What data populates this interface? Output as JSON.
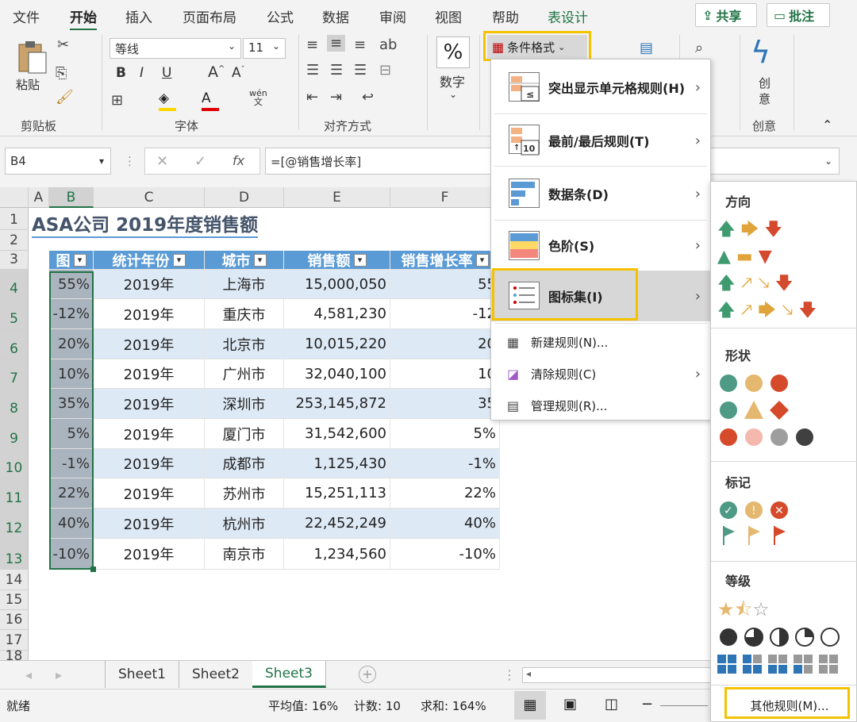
{
  "menu": {
    "tabs": [
      "文件",
      "开始",
      "插入",
      "页面布局",
      "公式",
      "数据",
      "审阅",
      "视图",
      "帮助",
      "表设计"
    ],
    "share_label": "共享",
    "comment_label": "批注"
  },
  "ribbon": {
    "paste_label": "粘贴",
    "clipboard_label": "剪贴板",
    "font_name": "等线",
    "font_size": "11",
    "font_group_label": "字体",
    "align_group_label": "对齐方式",
    "number_label": "数字",
    "cf_button_label": "条件格式",
    "create_label_1": "创",
    "create_label_2": "意",
    "create_group_label": "创意"
  },
  "formula_bar": {
    "name_box": "B4",
    "formula": "=[@销售增长率]"
  },
  "sheet": {
    "columns": [
      "A",
      "B",
      "C",
      "D",
      "E",
      "F"
    ],
    "title": "ASA公司 2019年度销售额",
    "headers": [
      "图",
      "统计年份",
      "城市",
      "销售额",
      "销售增长率"
    ],
    "rows": [
      {
        "icon": "55%",
        "year": "2019年",
        "city": "上海市",
        "sales": "15,000,050",
        "growth": "55"
      },
      {
        "icon": "-12%",
        "year": "2019年",
        "city": "重庆市",
        "sales": "4,581,230",
        "growth": "-12"
      },
      {
        "icon": "20%",
        "year": "2019年",
        "city": "北京市",
        "sales": "10,015,220",
        "growth": "20"
      },
      {
        "icon": "10%",
        "year": "2019年",
        "city": "广州市",
        "sales": "32,040,100",
        "growth": "10"
      },
      {
        "icon": "35%",
        "year": "2019年",
        "city": "深圳市",
        "sales": "253,145,872",
        "growth": "35"
      },
      {
        "icon": "5%",
        "year": "2019年",
        "city": "厦门市",
        "sales": "31,542,600",
        "growth": "5%"
      },
      {
        "icon": "-1%",
        "year": "2019年",
        "city": "成都市",
        "sales": "1,125,430",
        "growth": "-1%"
      },
      {
        "icon": "22%",
        "year": "2019年",
        "city": "苏州市",
        "sales": "15,251,113",
        "growth": "22%"
      },
      {
        "icon": "40%",
        "year": "2019年",
        "city": "杭州市",
        "sales": "22,452,249",
        "growth": "40%"
      },
      {
        "icon": "-10%",
        "year": "2019年",
        "city": "南京市",
        "sales": "1,234,560",
        "growth": "-10%"
      }
    ],
    "row_numbers": [
      "1",
      "2",
      "3",
      "4",
      "5",
      "6",
      "7",
      "8",
      "9",
      "10",
      "11",
      "12",
      "13",
      "14",
      "15",
      "16",
      "17",
      "18"
    ]
  },
  "cf_menu": {
    "highlight_rules": "突出显示单元格规则(H)",
    "top_bottom": "最前/最后规则(T)",
    "data_bars": "数据条(D)",
    "color_scales": "色阶(S)",
    "icon_sets": "图标集(I)",
    "new_rule": "新建规则(N)...",
    "clear_rules": "清除规则(C)",
    "manage_rules": "管理规则(R)..."
  },
  "icon_panel": {
    "direction": "方向",
    "shapes": "形状",
    "indicators": "标记",
    "ratings": "等级",
    "more_rules": "其他规则(M)..."
  },
  "tabs": [
    "Sheet1",
    "Sheet2",
    "Sheet3"
  ],
  "status": {
    "ready": "就绪",
    "average": "平均值: 16%",
    "count": "计数: 10",
    "sum": "求和: 164%"
  },
  "colors": {
    "excel_green": "#217346",
    "table_header": "#5b9bd5",
    "band": "#dde9f5",
    "highlight": "#f5c200"
  }
}
